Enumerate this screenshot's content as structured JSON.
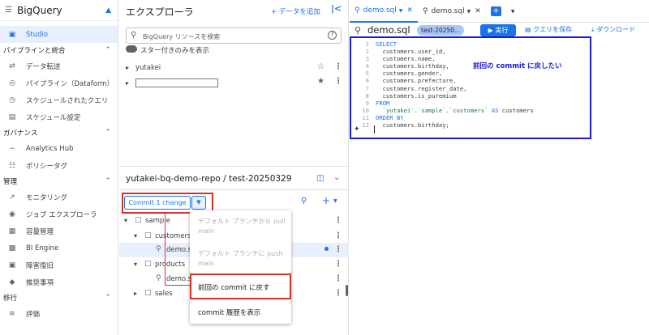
{
  "app": {
    "title": "BigQuery"
  },
  "nav": {
    "studio": "Studio",
    "pipelines_section": "パイプラインと統合",
    "data_transfer": "データ転送",
    "pipeline": "パイプライン（Dataform）",
    "scheduled_queries": "スケジュールされたクエリ",
    "schedule_settings": "スケジュール設定",
    "governance_section": "ガバナンス",
    "analytics_hub": "Analytics Hub",
    "policy_tags": "ポリシータグ",
    "admin_section": "管理",
    "monitoring": "モニタリング",
    "job_explorer": "ジョブ エクスプローラ",
    "capacity": "容量管理",
    "bi_engine": "BI Engine",
    "disaster_recovery": "障害復旧",
    "recommendations": "推奨事項",
    "migration_section": "移行",
    "evaluation": "評価"
  },
  "explorer": {
    "title": "エクスプローラ",
    "add_data": "+ データを追加",
    "search_placeholder": "BigQuery リソースを検索",
    "starred_only": "スター付きのみを表示",
    "project": "yutakei",
    "repo_title": "yutakei-bq-demo-repo / test-20250329",
    "commit_button": "Commit 1 change",
    "tree": {
      "sample": "sample",
      "customers": "customers",
      "customers_file": "demo.s",
      "products": "products",
      "products_file": "demo.s",
      "sales": "sales"
    },
    "menu": {
      "pull": "デフォルト ブランチから pull main",
      "push": "デフォルト ブランチに push main",
      "revert": "前回の commit に戻す",
      "history": "commit 履歴を表示"
    }
  },
  "editor": {
    "tabs": [
      "demo.sql",
      "demo.sql"
    ],
    "file_title": "demo.sql",
    "branch_chip": "test-20250...",
    "run": "実行",
    "save": "クエリを保存",
    "download": "ダウンロード",
    "annotation": "前回の commit に戻したい",
    "lines": [
      {
        "n": "1",
        "t": "SELECT",
        "c": "kw"
      },
      {
        "n": "2",
        "t": "  customers.user_id,",
        "c": ""
      },
      {
        "n": "3",
        "t": "  customers.name,",
        "c": ""
      },
      {
        "n": "4",
        "t": "  customers.birthday,",
        "c": ""
      },
      {
        "n": "5",
        "t": "  customers.gender,",
        "c": ""
      },
      {
        "n": "6",
        "t": "  customers.prefecture,",
        "c": ""
      },
      {
        "n": "7",
        "t": "  customers.register_date,",
        "c": ""
      },
      {
        "n": "8",
        "t": "  customers.is_puremium",
        "c": ""
      },
      {
        "n": "9",
        "t": "FROM",
        "c": "kw"
      },
      {
        "n": "10",
        "t": "  `yutakei`.`sample`.`customers` AS customers",
        "c": "mix"
      },
      {
        "n": "11",
        "t": "ORDER BY",
        "c": "kw"
      },
      {
        "n": "12",
        "t": "  customers.birthday;",
        "c": ""
      }
    ]
  },
  "colors": {
    "accent": "#1a73e8",
    "highlight": "#d93025",
    "annotation_box": "#1a1ad6"
  }
}
